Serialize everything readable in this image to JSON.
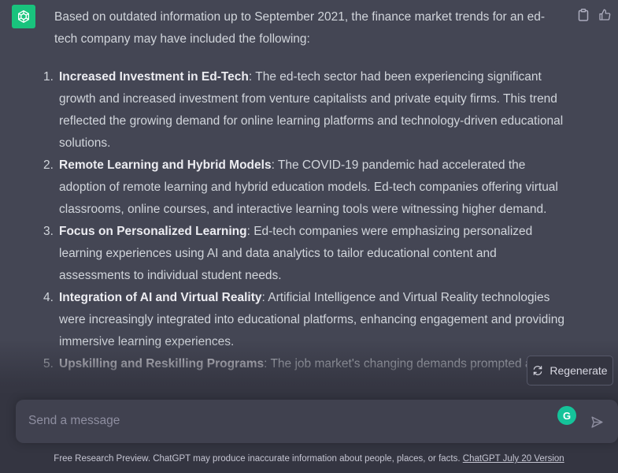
{
  "message": {
    "intro": "Based on outdated information up to September 2021, the finance market trends for an ed-tech company may have included the following:",
    "items": [
      {
        "number": "1.",
        "title": "Increased Investment in Ed-Tech",
        "text": ": The ed-tech sector had been experiencing significant growth and increased investment from venture capitalists and private equity firms. This trend reflected the growing demand for online learning platforms and technology-driven educational solutions."
      },
      {
        "number": "2.",
        "title": "Remote Learning and Hybrid Models",
        "text": ": The COVID-19 pandemic had accelerated the adoption of remote learning and hybrid education models. Ed-tech companies offering virtual classrooms, online courses, and interactive learning tools were witnessing higher demand."
      },
      {
        "number": "3.",
        "title": "Focus on Personalized Learning",
        "text": ": Ed-tech companies were emphasizing personalized learning experiences using AI and data analytics to tailor educational content and assessments to individual student needs."
      },
      {
        "number": "4.",
        "title": "Integration of AI and Virtual Reality",
        "text": ": Artificial Intelligence and Virtual Reality technologies were increasingly integrated into educational platforms, enhancing engagement and providing immersive learning experiences."
      },
      {
        "number": "5.",
        "title": "Upskilling and Reskilling Programs",
        "text": ": The job market's changing demands prompted a"
      }
    ]
  },
  "actions": {
    "copy_icon": "clipboard-icon",
    "like_icon": "thumbs-up-icon"
  },
  "regenerate": {
    "label": "Regenerate",
    "icon": "refresh-icon"
  },
  "composer": {
    "placeholder": "Send a message",
    "grammarly_letter": "G",
    "send_icon": "send-icon"
  },
  "footer": {
    "text": "Free Research Preview. ChatGPT may produce inaccurate information about people, places, or facts. ",
    "link": "ChatGPT July 20 Version"
  },
  "colors": {
    "background_message": "#444654",
    "background_bottom": "#343541",
    "avatar": "#19c37d",
    "input": "#40414f"
  }
}
